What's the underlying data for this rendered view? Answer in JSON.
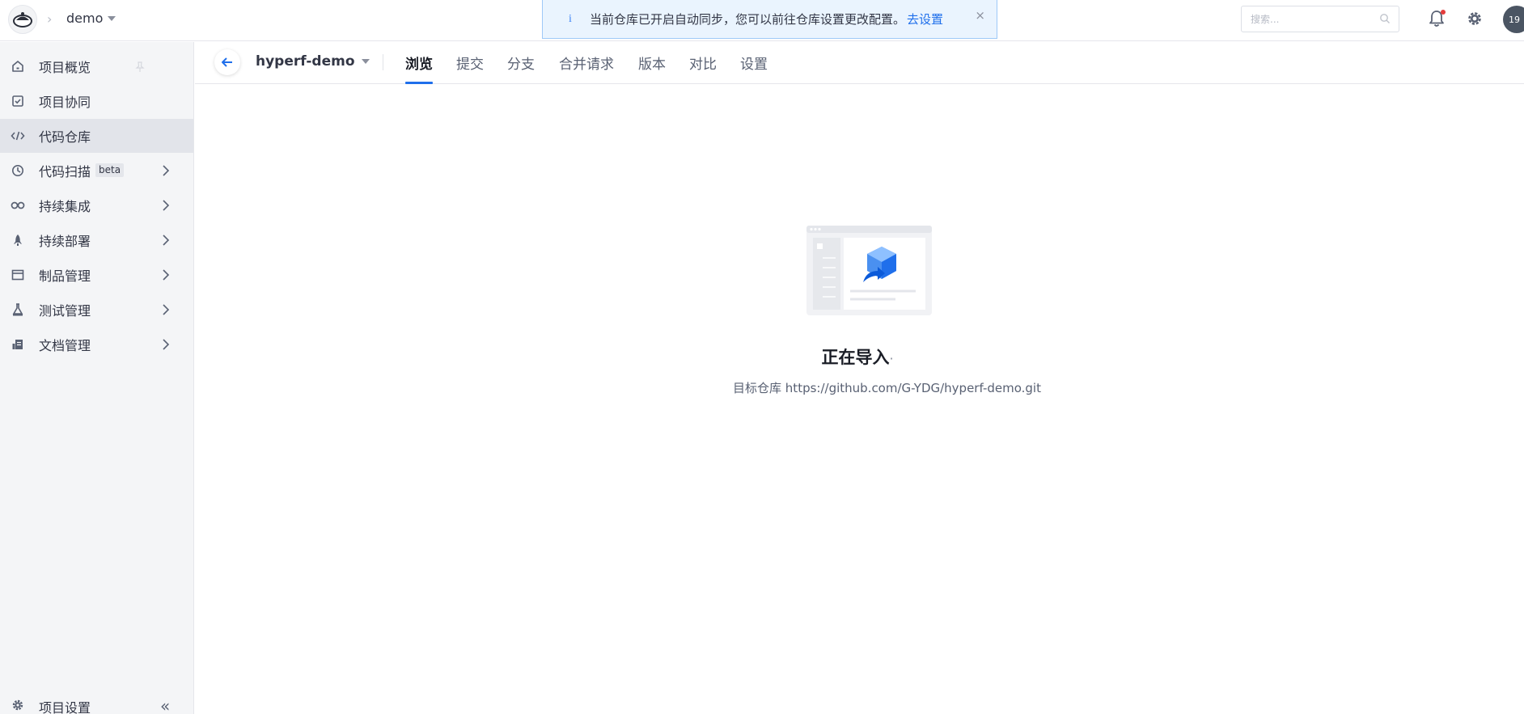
{
  "header": {
    "breadcrumb_project": "demo",
    "notice": {
      "info_glyph": "i",
      "text": "当前仓库已开启自动同步，您可以前往仓库设置更改配置。",
      "link": "去设置",
      "close": "×"
    },
    "search": {
      "placeholder": "搜索..."
    },
    "avatar_text": "19"
  },
  "sidebar": {
    "items": [
      {
        "label": "项目概览",
        "icon": "home-icon"
      },
      {
        "label": "项目协同",
        "icon": "check-square-icon"
      },
      {
        "label": "代码仓库",
        "icon": "code-icon",
        "active": true
      },
      {
        "label": "代码扫描",
        "icon": "scan-icon",
        "badge": "beta"
      },
      {
        "label": "持续集成",
        "icon": "infinity-icon"
      },
      {
        "label": "持续部署",
        "icon": "rocket-icon"
      },
      {
        "label": "制品管理",
        "icon": "box-icon"
      },
      {
        "label": "测试管理",
        "icon": "flask-icon"
      },
      {
        "label": "文档管理",
        "icon": "doc-icon"
      }
    ],
    "footer_label": "项目设置",
    "collapse_glyph": "«"
  },
  "repo": {
    "name": "hyperf-demo",
    "tabs": [
      "浏览",
      "提交",
      "分支",
      "合并请求",
      "版本",
      "对比",
      "设置"
    ],
    "active_tab": "浏览"
  },
  "content": {
    "title": "正在导入",
    "title_dots": "·",
    "subtitle": "目标仓库 https://github.com/G-YDG/hyperf-demo.git"
  },
  "colors": {
    "accent": "#1f6feb",
    "sidebar_bg": "#f4f5f7",
    "sidebar_active": "#e2e4ea",
    "notice_bg": "#eaf4fe"
  }
}
